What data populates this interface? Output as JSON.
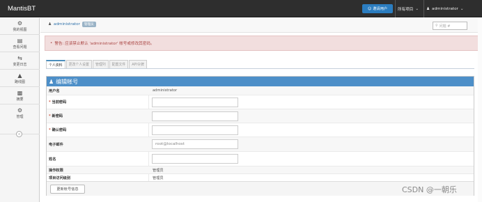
{
  "navbar": {
    "brand": "MantisBT",
    "invite_label": "邀请用户",
    "project_label": "所有项目",
    "user_label": "administrator"
  },
  "sidebar": {
    "items": [
      {
        "label": "我的视图",
        "icon": "dashboard-icon"
      },
      {
        "label": "查看问题",
        "icon": "list-icon"
      },
      {
        "label": "变更日志",
        "icon": "retweet-icon"
      },
      {
        "label": "路线图",
        "icon": "road-icon"
      },
      {
        "label": "摘要",
        "icon": "bar-chart-icon"
      },
      {
        "label": "管理",
        "icon": "gears-icon"
      }
    ]
  },
  "breadcrumb": {
    "user": "administrator",
    "badge": "管理员",
    "search_placeholder": "问题 #"
  },
  "alert": {
    "text": "警告: 应该禁止默认 'administrator' 帐号或修改其密码。"
  },
  "tabs": [
    {
      "label": "个人资料",
      "active": true
    },
    {
      "label": "更改个人设置",
      "active": false
    },
    {
      "label": "管理列",
      "active": false
    },
    {
      "label": "配置文件",
      "active": false
    },
    {
      "label": "API令牌",
      "active": false
    }
  ],
  "form": {
    "title": "编辑帐号",
    "rows": [
      {
        "label": "用户名",
        "value": "administrator",
        "type": "text",
        "required": false
      },
      {
        "label": "当前密码",
        "value": "",
        "type": "input",
        "required": true
      },
      {
        "label": "新密码",
        "value": "",
        "type": "input",
        "required": true
      },
      {
        "label": "确认密码",
        "value": "",
        "type": "input",
        "required": true
      },
      {
        "label": "电子邮件",
        "value": "root@localhost",
        "type": "input",
        "required": false
      },
      {
        "label": "姓名",
        "value": "",
        "type": "input",
        "required": false
      },
      {
        "label": "操作权限",
        "value": "管理员",
        "type": "text",
        "required": false
      },
      {
        "label": "项目访问级别",
        "value": "管理员",
        "type": "text",
        "required": false
      }
    ],
    "submit_label": "更新帐号信息"
  },
  "watermark": "CSDN @一朝乐"
}
